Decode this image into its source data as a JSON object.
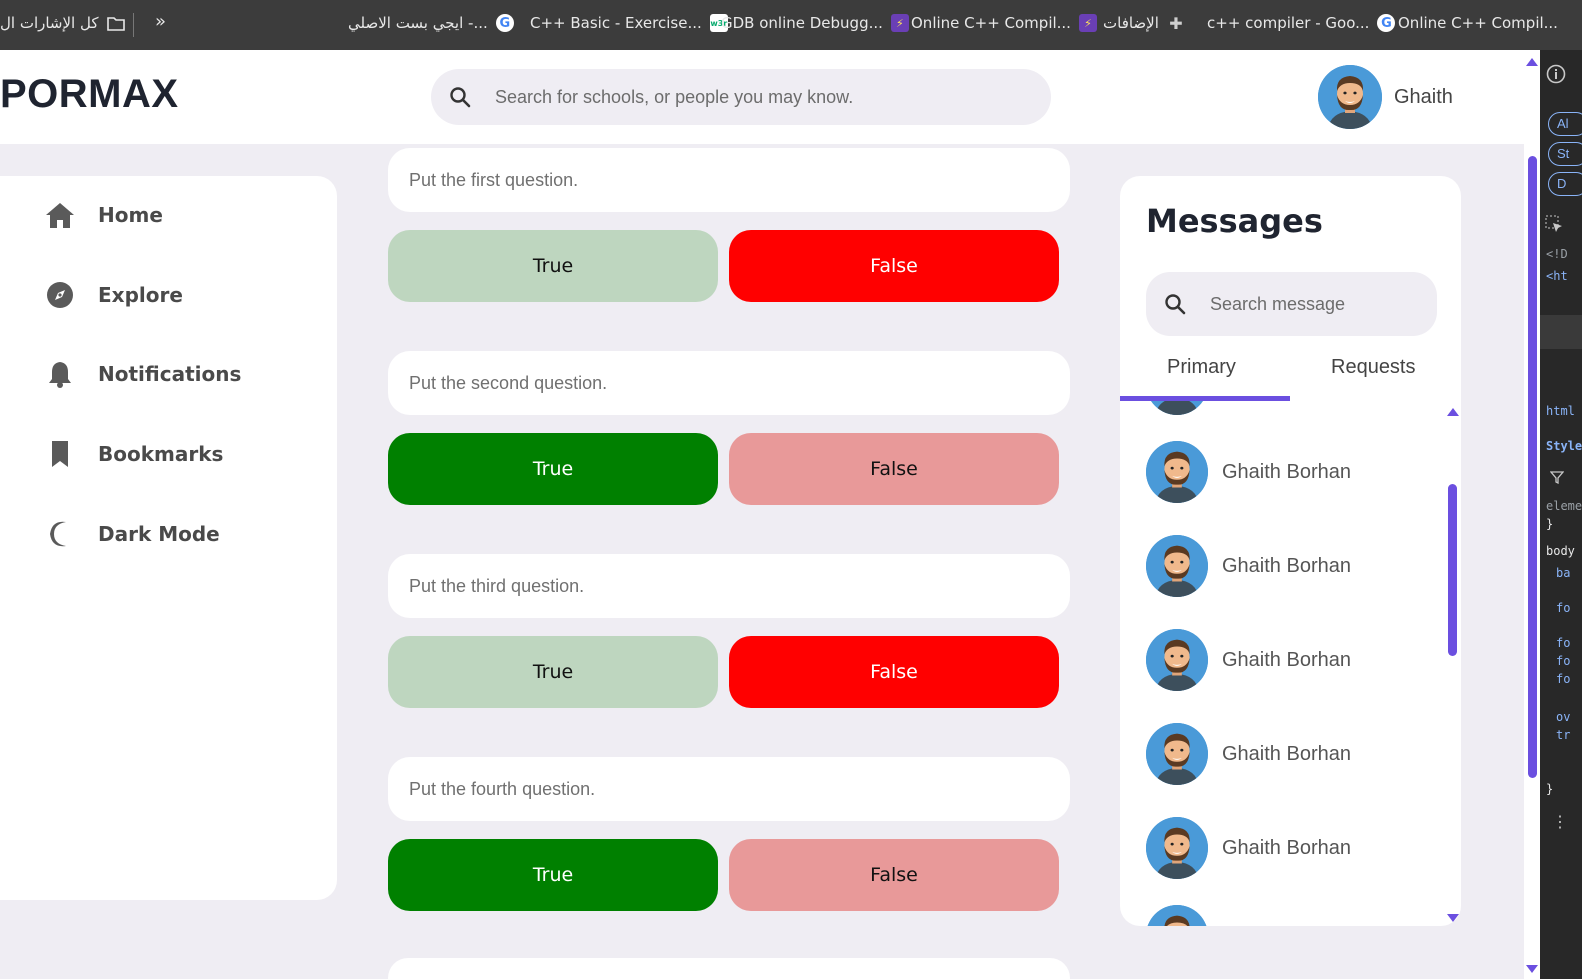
{
  "bookmarks": {
    "all_bookmarks": "كل الإشارات ال",
    "overflow": "»",
    "items": [
      {
        "label": "ايجي بست الاصلي -...",
        "icon": "google-icon"
      },
      {
        "label": "C++ Basic - Exercise...",
        "icon": "w3schools-icon"
      },
      {
        "label": "GDB online Debugg...",
        "icon": "bolt-icon"
      },
      {
        "label": "Online C++ Compil...",
        "icon": "bolt-icon"
      },
      {
        "label": "الإضافات",
        "icon": "puzzle-icon"
      },
      {
        "label": "c++ compiler - Goo...",
        "icon": "google-icon"
      },
      {
        "label": "Online C++ Compil...",
        "icon": "bolt-icon"
      }
    ],
    "w3_text": "w3r"
  },
  "header": {
    "logo": "PORMAX",
    "search_placeholder": "Search for schools, or people you may know.",
    "user_name": "Ghaith"
  },
  "sidebar": {
    "items": [
      {
        "label": "Home",
        "icon": "home-icon"
      },
      {
        "label": "Explore",
        "icon": "compass-icon"
      },
      {
        "label": "Notifications",
        "icon": "bell-icon"
      },
      {
        "label": "Bookmarks",
        "icon": "bookmark-icon"
      },
      {
        "label": "Dark Mode",
        "icon": "moon-icon"
      }
    ]
  },
  "questions": [
    {
      "placeholder": "Put the first question.",
      "true_label": "True",
      "false_label": "False",
      "selected": "false"
    },
    {
      "placeholder": "Put the second question.",
      "true_label": "True",
      "false_label": "False",
      "selected": "true"
    },
    {
      "placeholder": "Put the third question.",
      "true_label": "True",
      "false_label": "False",
      "selected": "false"
    },
    {
      "placeholder": "Put the fourth question.",
      "true_label": "True",
      "false_label": "False",
      "selected": "true"
    }
  ],
  "messages": {
    "title": "Messages",
    "search_placeholder": "Search message",
    "tabs": [
      {
        "label": "Primary",
        "active": true
      },
      {
        "label": "Requests",
        "active": false
      }
    ],
    "contacts": [
      {
        "name": "Ghaith Borhan"
      },
      {
        "name": "Ghaith Borhan"
      },
      {
        "name": "Ghaith Borhan"
      },
      {
        "name": "Ghaith Borhan"
      },
      {
        "name": "Ghaith Borhan"
      }
    ]
  },
  "devtools": {
    "pills": [
      "Al",
      "St",
      "D"
    ],
    "lines": [
      "<!D",
      "<ht",
      "html",
      "Style",
      "eleme",
      "}",
      "body",
      "ba",
      "fo",
      "fo",
      "fo",
      "fo",
      "ov",
      "tr",
      "}"
    ]
  },
  "colors": {
    "accent": "#6b4fe0",
    "true_selected": "#008000",
    "true_unselected": "#bed6bf",
    "false_selected": "#ff0000",
    "false_unselected": "#e89999",
    "page_bg": "#efedf3"
  }
}
